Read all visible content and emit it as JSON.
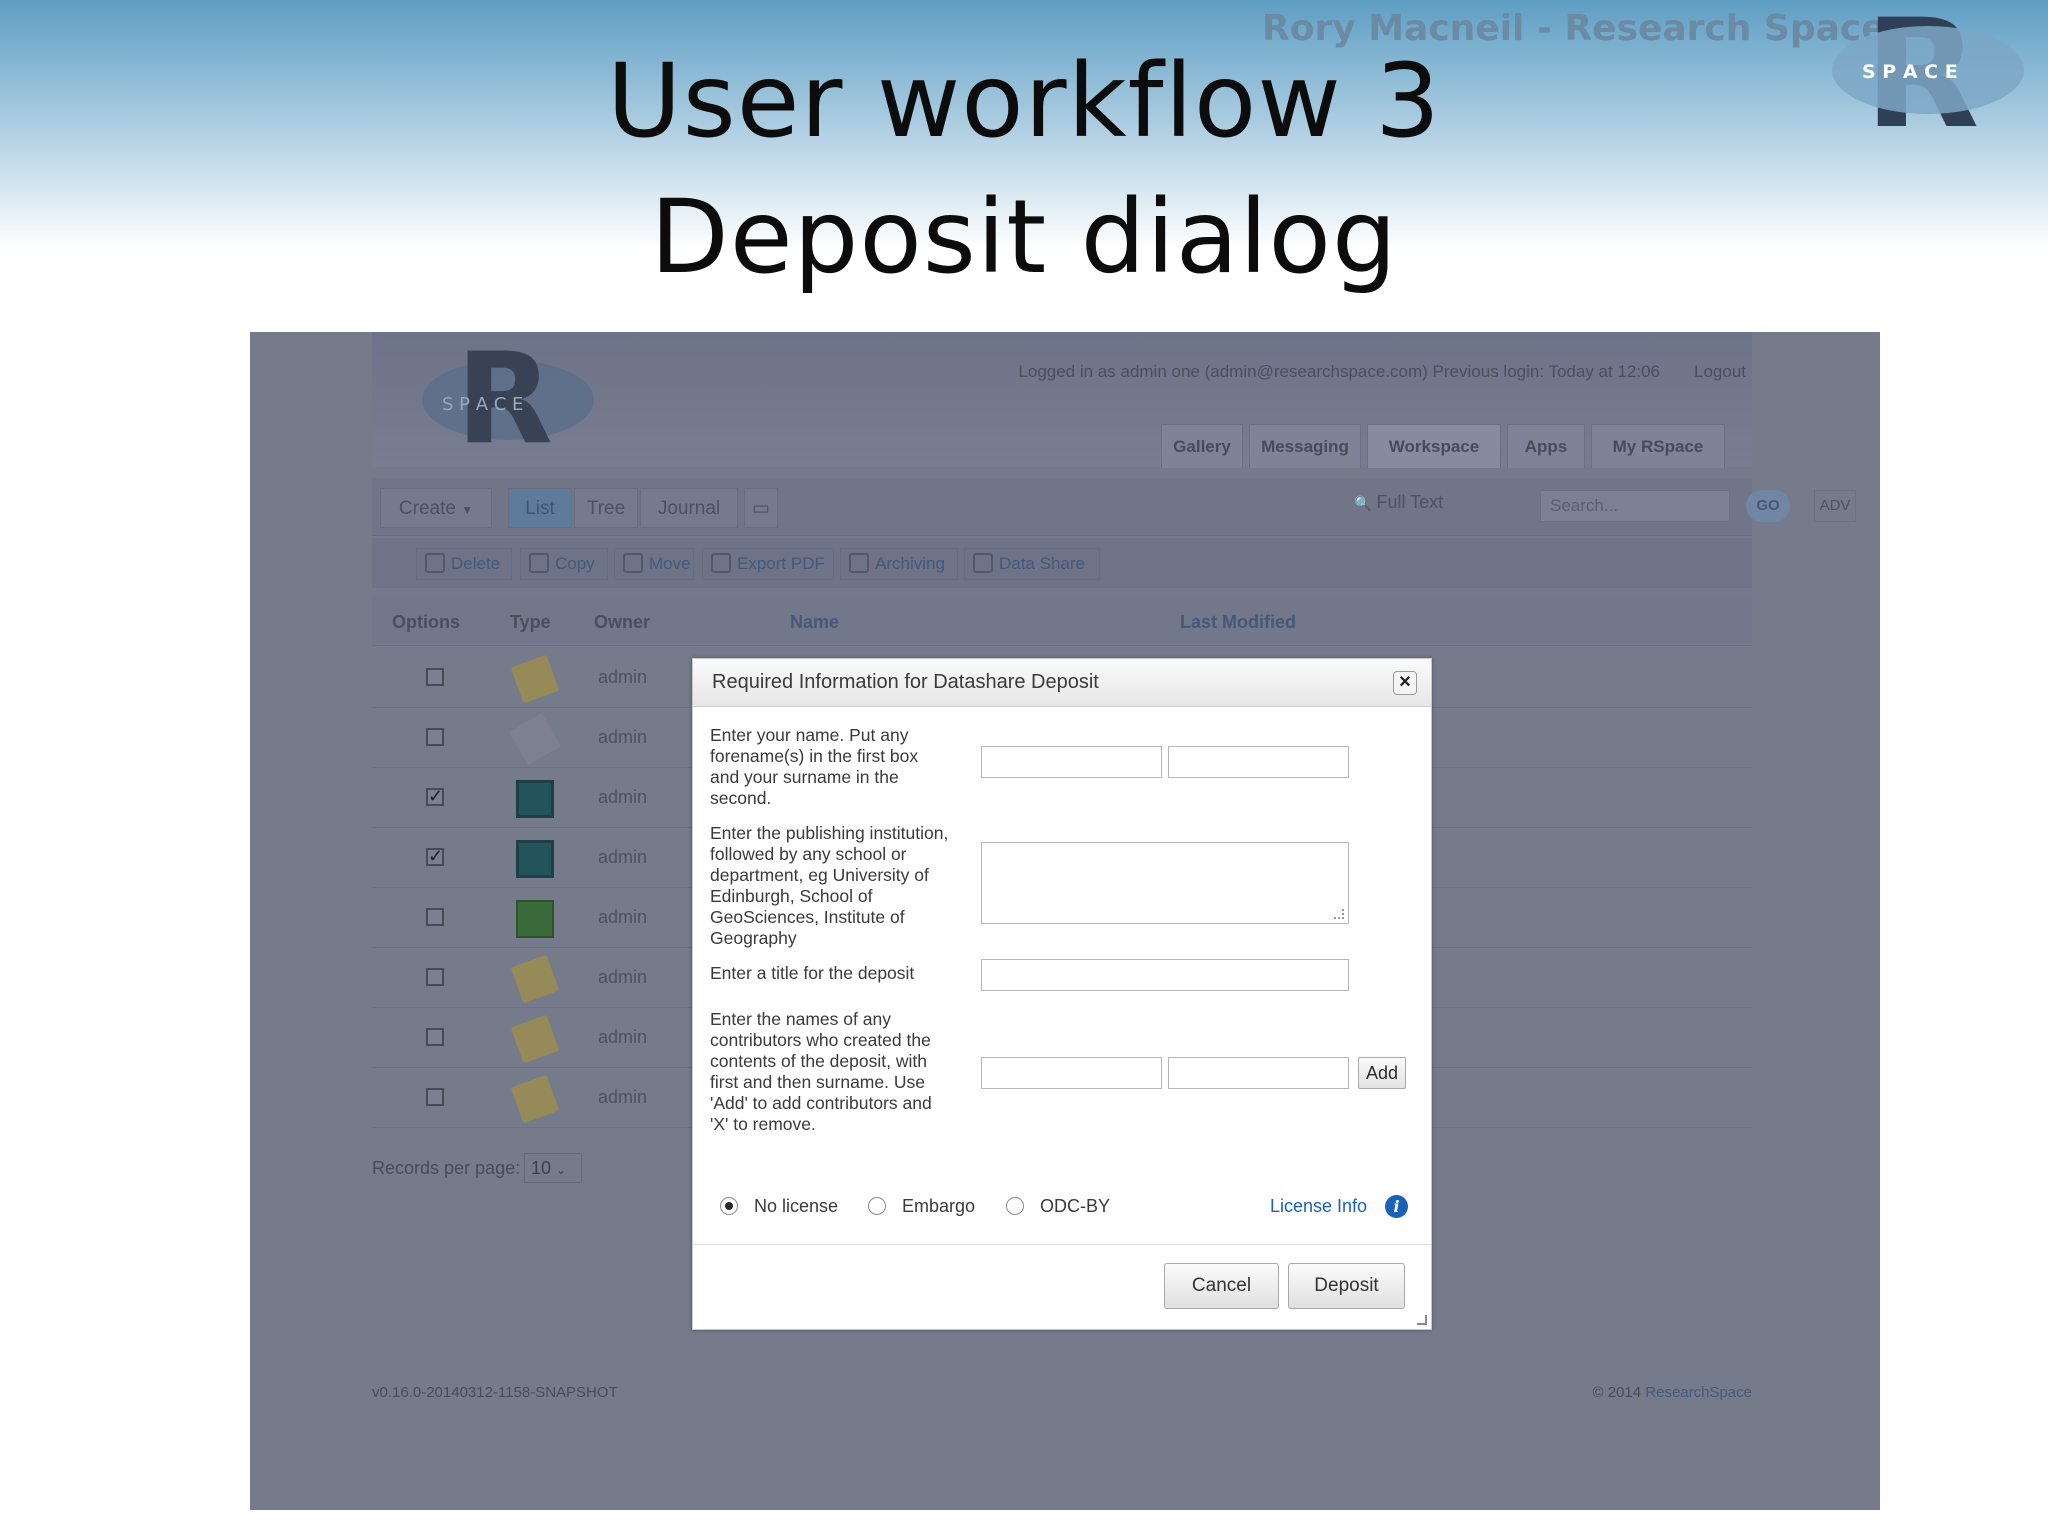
{
  "slide": {
    "title_line1": "User workflow 3",
    "title_line2": "Deposit dialog",
    "author": "Rory Macneil - Research Space",
    "logo_text": "S P A C E"
  },
  "app": {
    "logo_text": "S P A C E",
    "login_info": "Logged in as admin one (admin@researchspace.com) Previous login: Today at 12:06",
    "logout": "Logout",
    "nav_tabs": [
      "Gallery",
      "Messaging",
      "Workspace",
      "Apps",
      "My RSpace"
    ],
    "active_tab": "Workspace",
    "toolbar": {
      "create": "Create",
      "views": [
        "List",
        "Tree",
        "Journal"
      ],
      "active_view": "List",
      "fulltext": "Full Text",
      "search_placeholder": "Search...",
      "go": "GO",
      "adv": "ADV"
    },
    "actions": [
      "Delete",
      "Copy",
      "Move",
      "Export PDF",
      "Archiving",
      "Data Share"
    ],
    "table": {
      "headers": [
        "Options",
        "Type",
        "Owner",
        "Name",
        "Last Modified"
      ],
      "rows": [
        {
          "checked": false,
          "type": "note-icon",
          "owner": "admin"
        },
        {
          "checked": false,
          "type": "note-icon",
          "owner": "admin"
        },
        {
          "checked": true,
          "type": "notebook-icon",
          "owner": "admin"
        },
        {
          "checked": true,
          "type": "notebook-icon",
          "owner": "admin"
        },
        {
          "checked": false,
          "type": "spreadsheet-icon",
          "owner": "admin"
        },
        {
          "checked": false,
          "type": "note-icon",
          "owner": "admin"
        },
        {
          "checked": false,
          "type": "note-icon",
          "owner": "admin"
        },
        {
          "checked": false,
          "type": "note-icon",
          "owner": "admin"
        }
      ]
    },
    "records_per_page_label": "Records per page:",
    "records_per_page": "10",
    "version": "v0.16.0-20140312-1158-SNAPSHOT",
    "copyright_prefix": "© 2014",
    "copyright_link": "ResearchSpace"
  },
  "dialog": {
    "title": "Required Information for Datashare Deposit",
    "name_label": "Enter your name. Put any forename(s) in the first box and your surname in the second.",
    "institution_label": "Enter the publishing institution, followed by any school or department, eg University of Edinburgh, School of GeoSciences, Institute of Geography",
    "title_label": "Enter a title for the deposit",
    "contributors_label": "Enter the names of any contributors who created the contents of the deposit, with first and then surname. Use 'Add' to add contributors and 'X' to remove.",
    "add_button": "Add",
    "license_options": [
      "No license",
      "Embargo",
      "ODC-BY"
    ],
    "selected_license": "No license",
    "license_info": "License Info",
    "cancel": "Cancel",
    "deposit": "Deposit"
  },
  "colors": {
    "link_blue": "#1a61b8",
    "overlay_grey": "#767b8c"
  }
}
